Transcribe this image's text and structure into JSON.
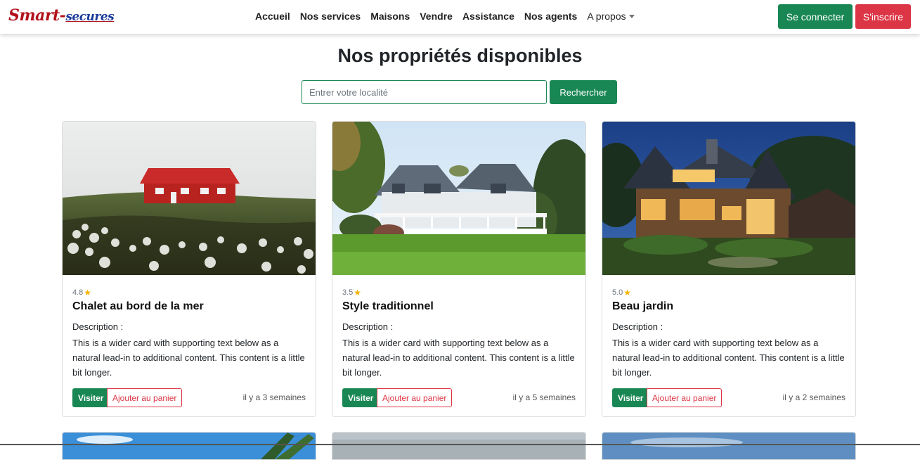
{
  "brand": {
    "part1": "Smart-",
    "part2": "secures"
  },
  "nav": {
    "items": [
      "Accueil",
      "Nos services",
      "Maisons",
      "Vendre",
      "Assistance",
      "Nos agents"
    ],
    "dropdown_label": "A propos"
  },
  "auth": {
    "login_label": "Se connecter",
    "signup_label": "S'inscrire"
  },
  "page_title": "Nos propriétés disponibles",
  "search": {
    "placeholder": "Entrer votre localité",
    "button_label": "Rechercher"
  },
  "cards": [
    {
      "rating": "4.8",
      "title": "Chalet au bord de la mer",
      "description_label": "Description :",
      "description": "This is a wider card with supporting text below as a natural lead-in to additional content. This content is a little bit longer.",
      "visit_label": "Visiter",
      "cart_label": "Ajouter au panier",
      "time": "il y a 3 semaines"
    },
    {
      "rating": "3.5",
      "title": "Style traditionnel",
      "description_label": "Description :",
      "description": "This is a wider card with supporting text below as a natural lead-in to additional content. This content is a little bit longer.",
      "visit_label": "Visiter",
      "cart_label": "Ajouter au panier",
      "time": "il y a 5 semaines"
    },
    {
      "rating": "5.0",
      "title": "Beau jardin",
      "description_label": "Description :",
      "description": "This is a wider card with supporting text below as a natural lead-in to additional content. This content is a little bit longer.",
      "visit_label": "Visiter",
      "cart_label": "Ajouter au panier",
      "time": "il y a 2 semaines"
    }
  ],
  "colors": {
    "primary": "#198754",
    "danger": "#dc3545",
    "star": "#f5b301"
  }
}
